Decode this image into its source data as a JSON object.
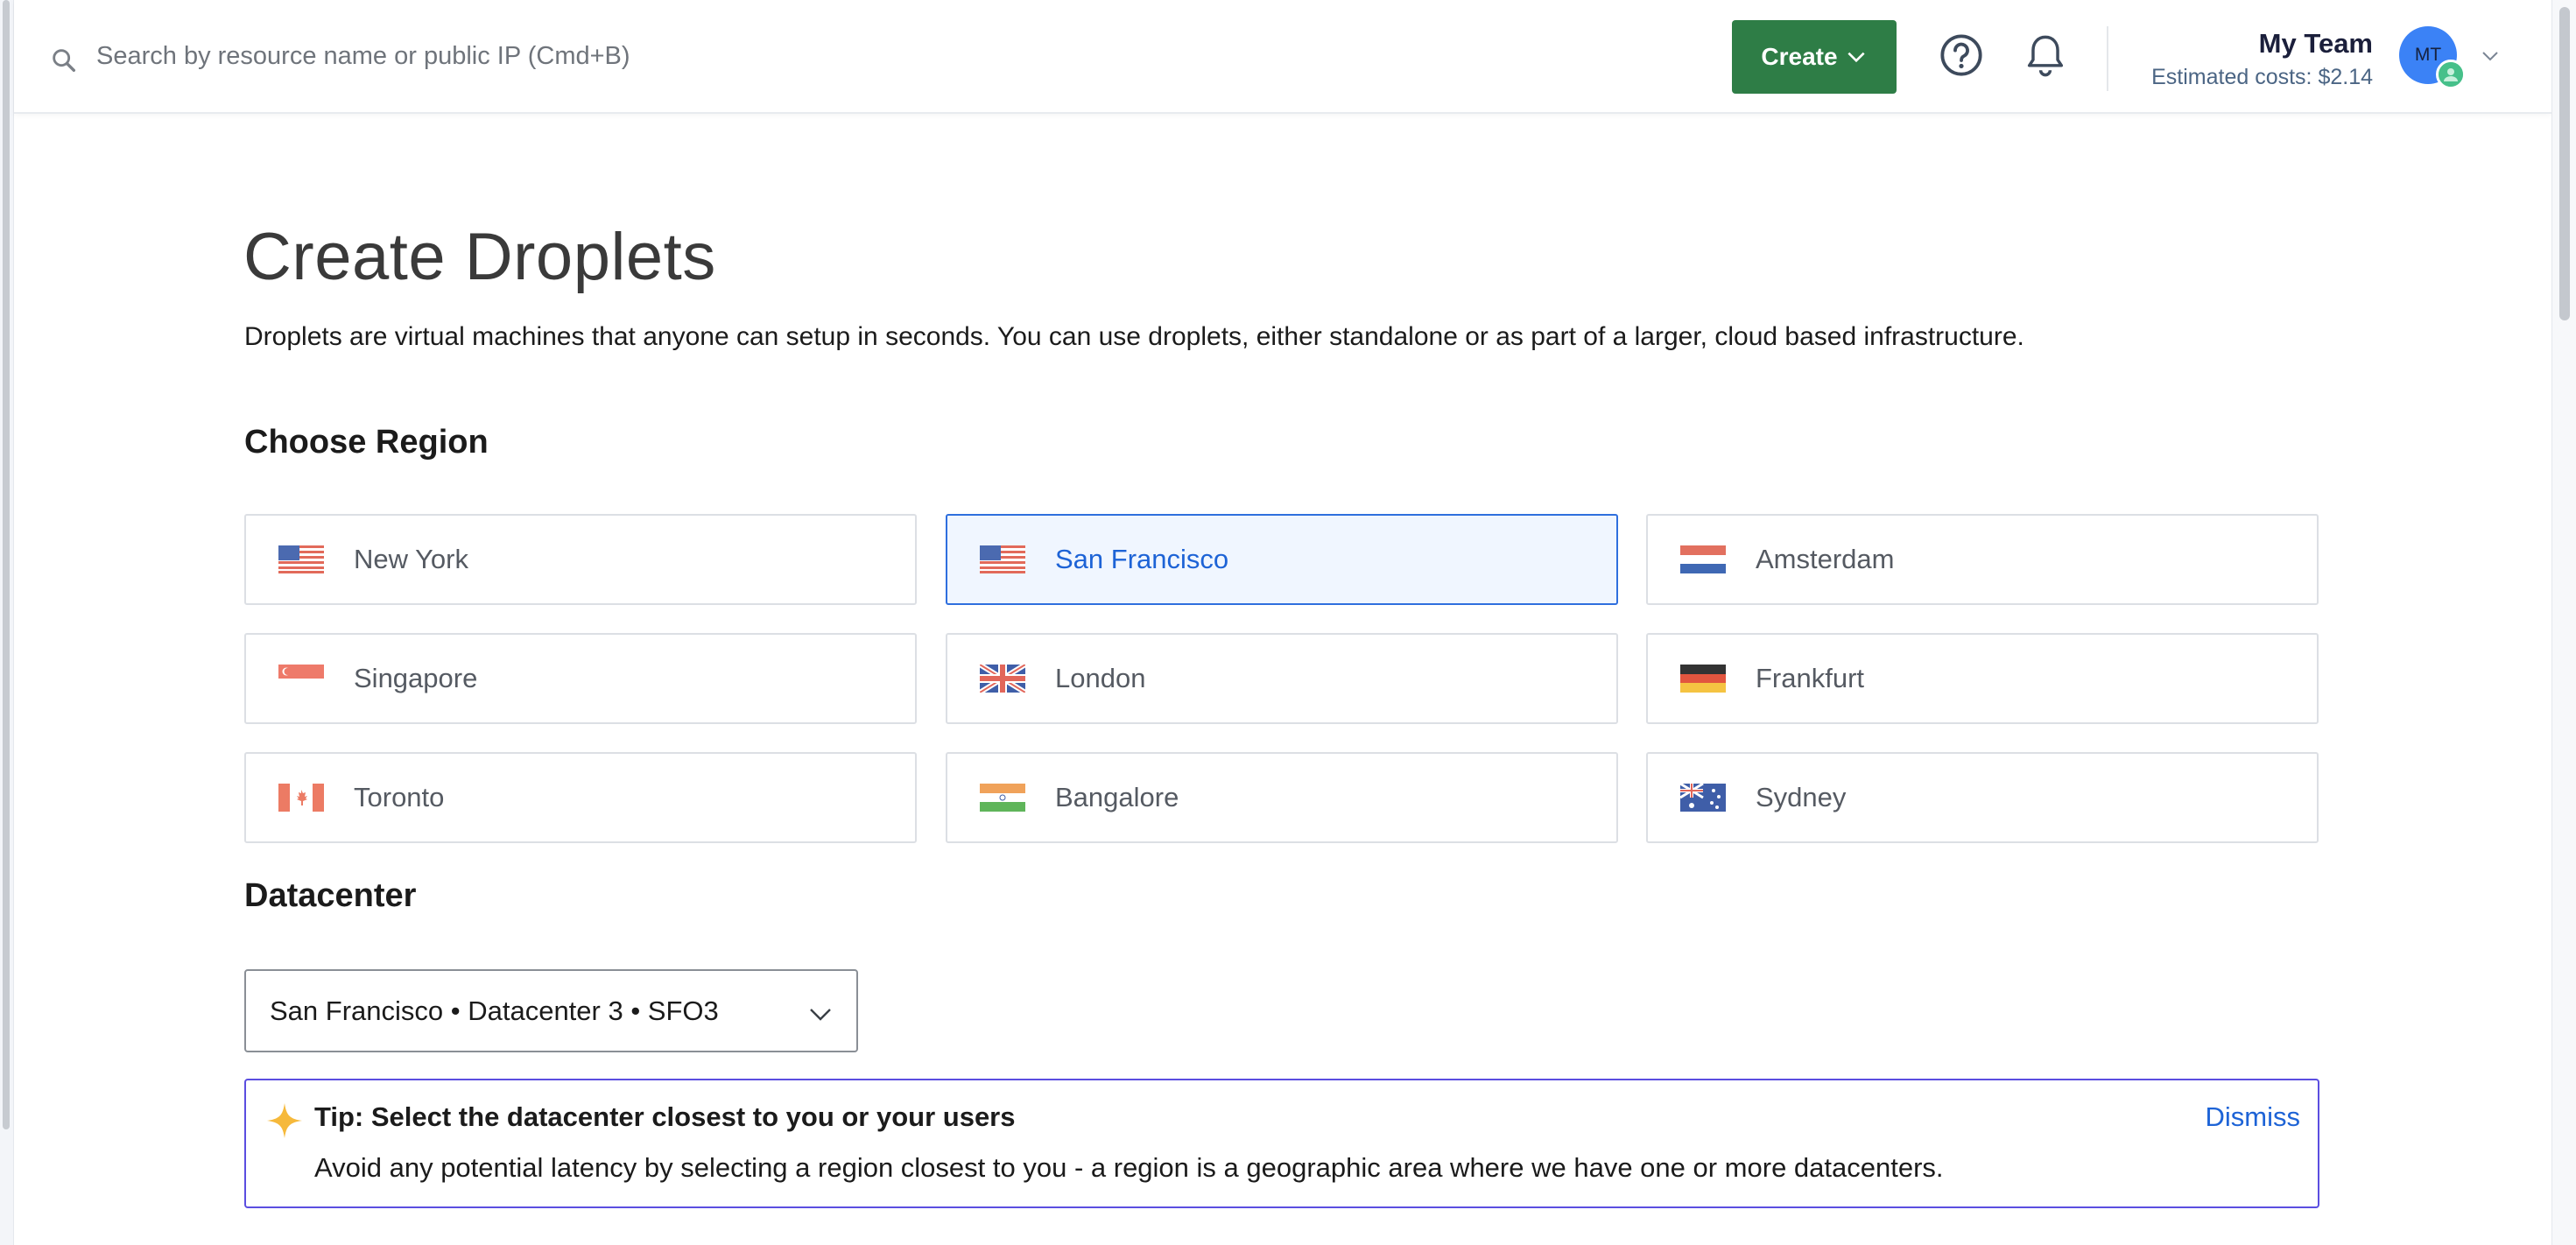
{
  "header": {
    "search_placeholder": "Search by resource name or public IP (Cmd+B)",
    "create_label": "Create",
    "team_name": "My Team",
    "estimated_costs": "Estimated costs: $2.14",
    "avatar_initials": "MT"
  },
  "main": {
    "title": "Create Droplets",
    "description": "Droplets are virtual machines that anyone can setup in seconds. You can use droplets, either standalone or as part of a larger, cloud based infrastructure.",
    "region_heading": "Choose Region",
    "regions": [
      {
        "label": "New York",
        "flag": "us-flag",
        "selected": false
      },
      {
        "label": "San Francisco",
        "flag": "us-flag",
        "selected": true
      },
      {
        "label": "Amsterdam",
        "flag": "netherlands-flag",
        "selected": false
      },
      {
        "label": "Singapore",
        "flag": "singapore-flag",
        "selected": false
      },
      {
        "label": "London",
        "flag": "uk-flag",
        "selected": false
      },
      {
        "label": "Frankfurt",
        "flag": "germany-flag",
        "selected": false
      },
      {
        "label": "Toronto",
        "flag": "canada-flag",
        "selected": false
      },
      {
        "label": "Bangalore",
        "flag": "india-flag",
        "selected": false
      },
      {
        "label": "Sydney",
        "flag": "australia-flag",
        "selected": false
      }
    ],
    "datacenter_heading": "Datacenter",
    "datacenter_value": "San Francisco • Datacenter 3 • SFO3",
    "tip": {
      "title": "Tip: Select the datacenter closest to you or your users",
      "body": "Avoid any potential latency by selecting a region closest to you - a region is a geographic area where we have one or more datacenters.",
      "dismiss_label": "Dismiss"
    }
  },
  "colors": {
    "create_button": "#2e7d46",
    "selected_border": "#2f6fde",
    "selected_text": "#1d63d6",
    "tip_border": "#5b4ee0",
    "avatar": "#3b82f6"
  }
}
